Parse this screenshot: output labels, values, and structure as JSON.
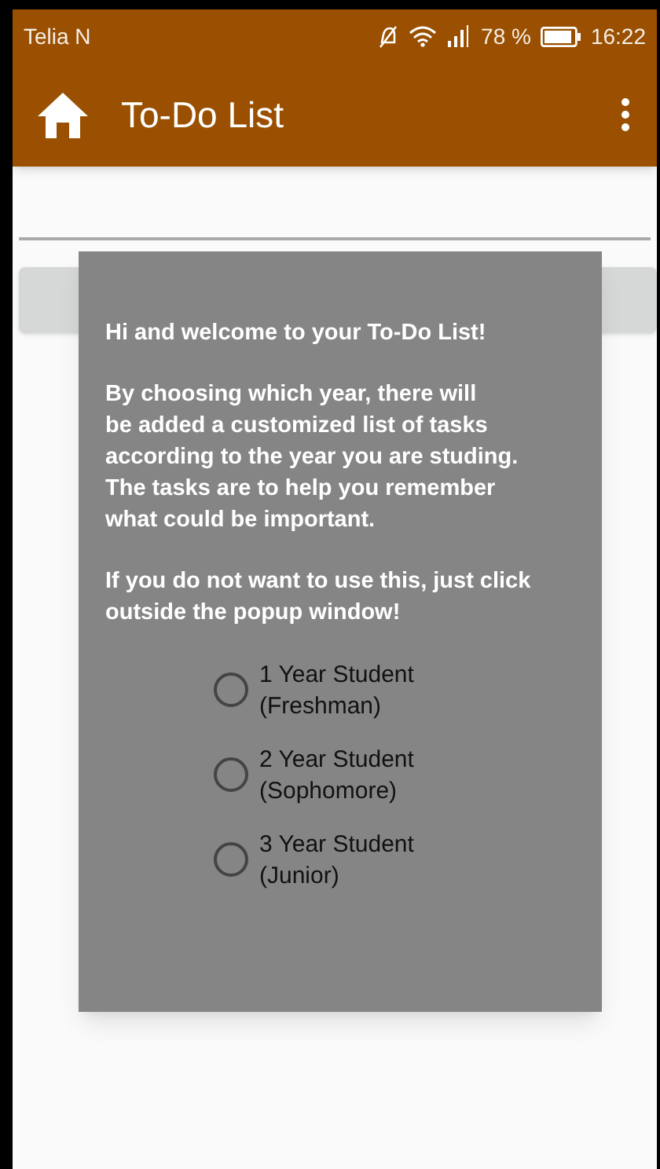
{
  "status_bar": {
    "carrier": "Telia N",
    "battery_percent": "78 %",
    "time": "16:22"
  },
  "app_bar": {
    "title": "To-Do List"
  },
  "popup": {
    "paragraphs": [
      "Hi and welcome to your To-Do List!",
      "By choosing which year, there will\nbe added a customized list of tasks\naccording to the year you are studing.\nThe tasks are to help you remember\nwhat could be important.",
      "If you do not want to use this, just click\noutside the popup window!"
    ],
    "options": [
      {
        "label": "1 Year Student",
        "detail": "(Freshman)",
        "selected": false
      },
      {
        "label": "2 Year Student",
        "detail": "(Sophomore)",
        "selected": false
      },
      {
        "label": "3 Year Student",
        "detail": "(Junior)",
        "selected": false
      }
    ]
  }
}
